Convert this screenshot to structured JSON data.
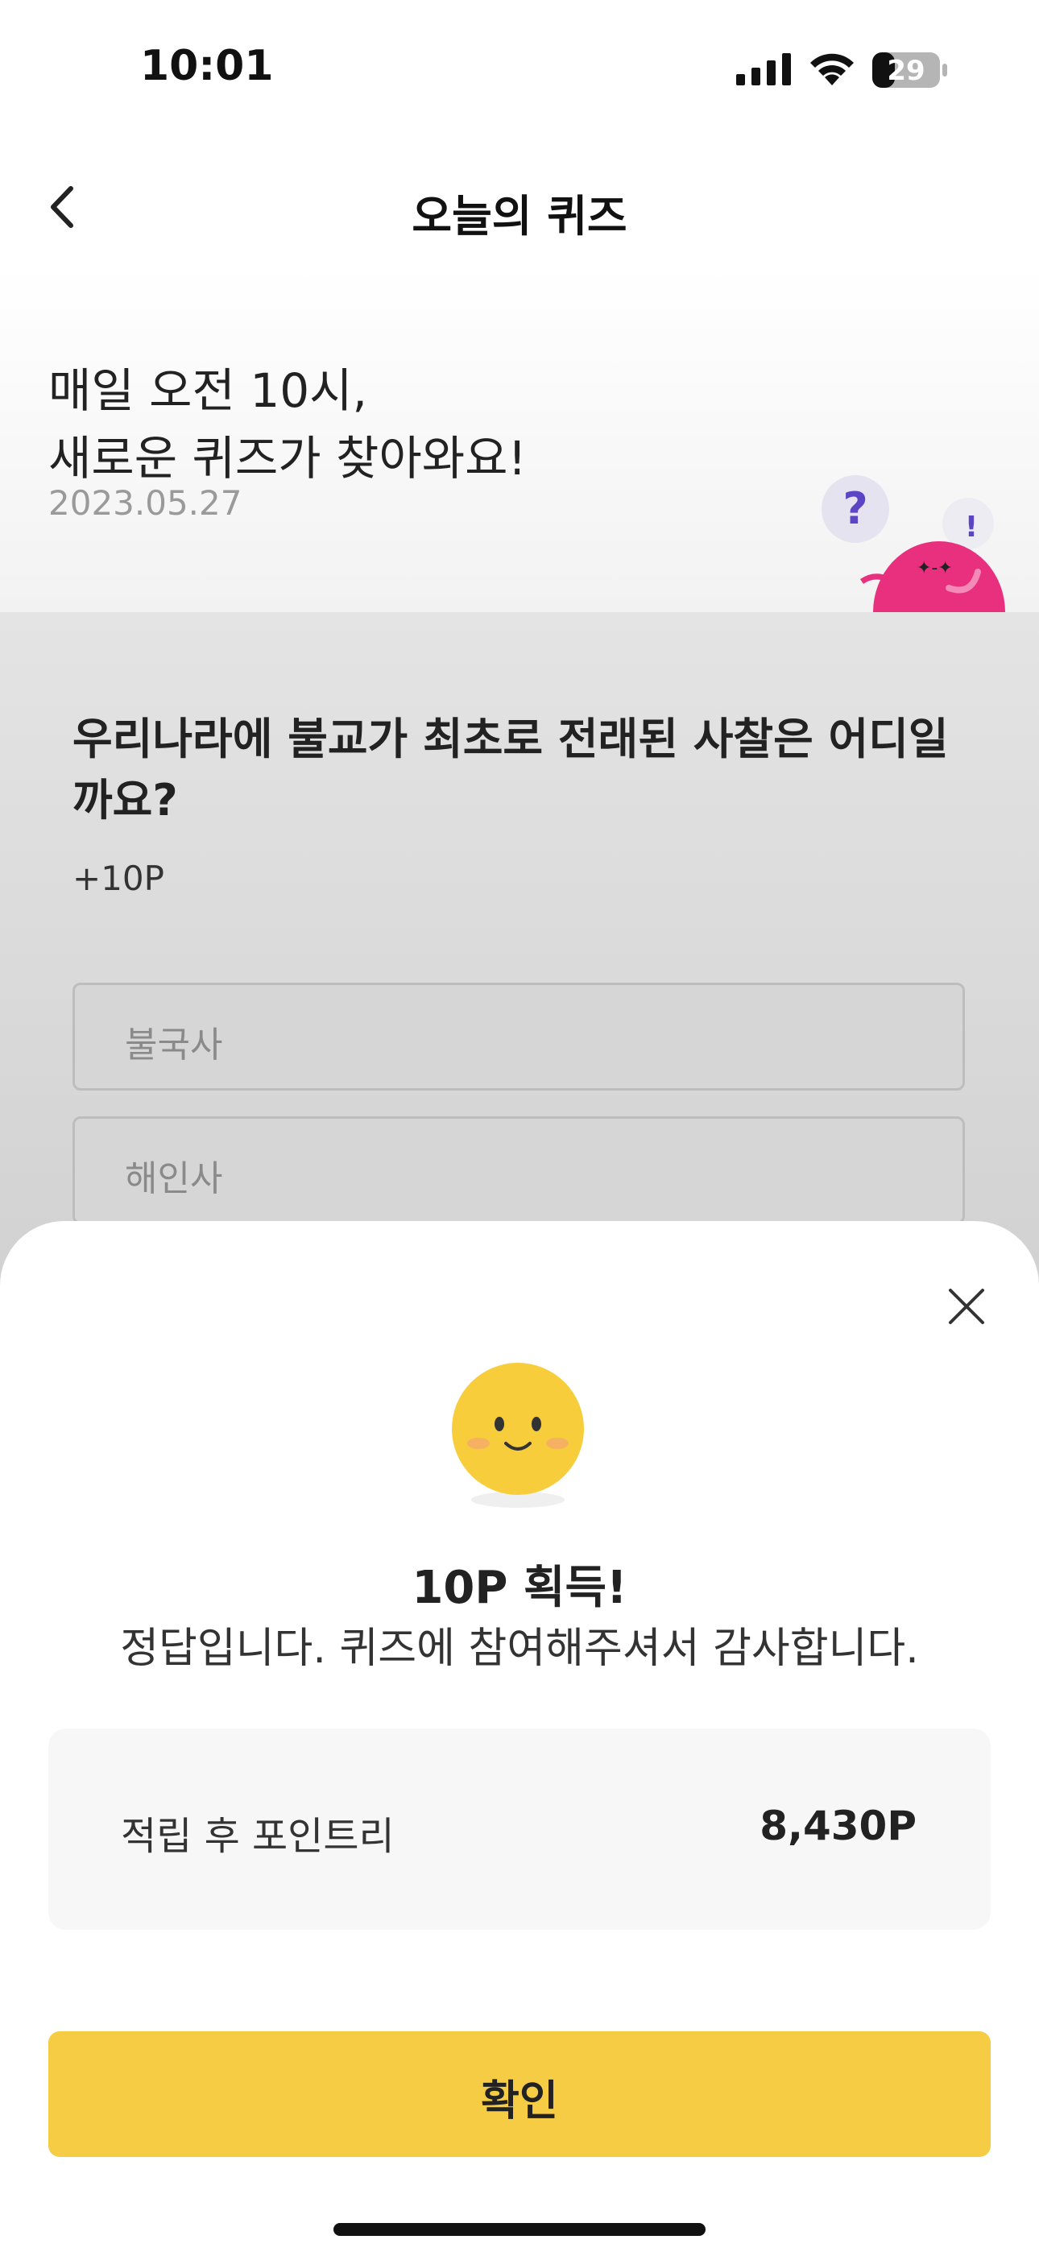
{
  "status_bar": {
    "time": "10:01",
    "battery": "29"
  },
  "header": {
    "title": "오늘의 퀴즈"
  },
  "hero": {
    "line1": "매일 오전 10시,",
    "line2": "새로운 퀴즈가 찾아와요!",
    "date": "2023.05.27"
  },
  "quiz": {
    "question": "우리나라에 불교가 최초로 전래된 사찰은 어디일까요?",
    "reward": "+10P",
    "options": [
      {
        "label": "불국사"
      },
      {
        "label": "해인사"
      }
    ]
  },
  "result": {
    "title": "10P 획득!",
    "message": "정답입니다. 퀴즈에 참여해주셔서 감사합니다.",
    "points_label": "적립 후 포인트리",
    "points_value": "8,430P",
    "confirm_label": "확인"
  },
  "colors": {
    "accent": "#f6cc44",
    "mascot": "#e8307f",
    "emoji": "#f7cd3c"
  }
}
